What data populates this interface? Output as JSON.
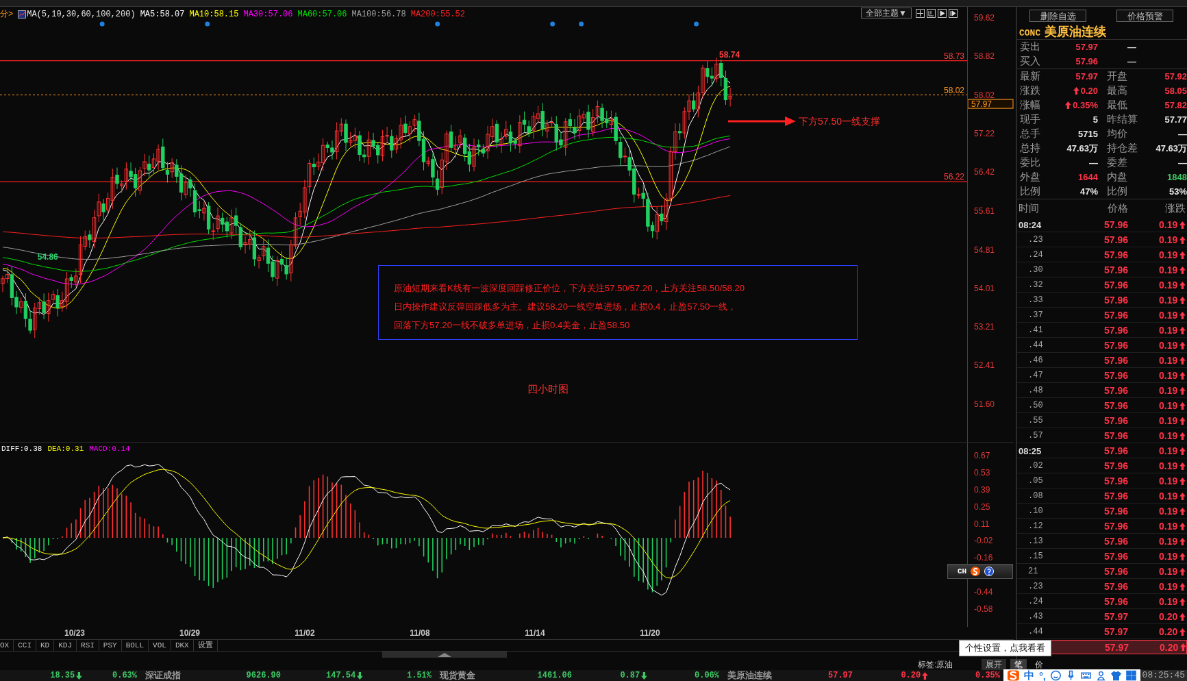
{
  "legend": {
    "period": "分>",
    "formula": "MA(5,10,30,60,100,200)",
    "values": [
      {
        "label": "MA5:58.07",
        "color": "#ffffff"
      },
      {
        "label": "MA10:58.15",
        "color": "#ffff00"
      },
      {
        "label": "MA30:57.06",
        "color": "#ff00ff"
      },
      {
        "label": "MA60:57.06",
        "color": "#00e000"
      },
      {
        "label": "MA100:56.78",
        "color": "#a0a0a0"
      },
      {
        "label": "MA200:55.52",
        "color": "#ff2020"
      }
    ]
  },
  "theme_button": "全部主题▼",
  "price_axis": [
    "59.62",
    "58.82",
    "58.02",
    "57.22",
    "56.42",
    "55.61",
    "54.81",
    "54.01",
    "53.21",
    "52.41",
    "51.60"
  ],
  "price_markers": [
    {
      "label": "58.73",
      "kind": "line"
    },
    {
      "label": "58.02",
      "kind": "dashed"
    },
    {
      "label": "57.97",
      "kind": "current"
    },
    {
      "label": "56.22",
      "kind": "line"
    }
  ],
  "extremes": [
    {
      "label": "58.74",
      "kind": "high"
    },
    {
      "label": "54.86",
      "kind": "low"
    }
  ],
  "callout": "下方57.50一线支撑",
  "note": [
    "原油短期来看K线有一波深度回踩修正价位，下方关注57.50/57.20，上方关注58.50/58.20",
    "日内操作建议反弹回踩低多为主。建议58.20一线空单进场，止损0.4，止盈57.50一线，",
    "回落下方57.20一线不破多单进场，止损0.4美金，止盈58.50"
  ],
  "caption": "四小时图",
  "macd_legend": [
    {
      "label": "DIFF:0.38",
      "color": "#ffffff"
    },
    {
      "label": "DEA:0.31",
      "color": "#ffff00"
    },
    {
      "label": "MACD:0.14",
      "color": "#ff00ff"
    }
  ],
  "macd_axis": [
    "0.67",
    "0.53",
    "0.39",
    "0.25",
    "0.11",
    "-0.02",
    "-0.16",
    "-0.44",
    "-0.58"
  ],
  "dates": [
    "10/23",
    "10/29",
    "11/02",
    "11/08",
    "11/14",
    "11/20"
  ],
  "indicator_tabs": [
    "OX",
    "CCI",
    "KD",
    "KDJ",
    "RSI",
    "PSY",
    "BOLL",
    "VOL",
    "DKX",
    "设置"
  ],
  "tag_label": "标签:原油",
  "expand_button": "展开",
  "detail_tabs": [
    {
      "label": "笔",
      "selected": true
    },
    {
      "label": "价",
      "selected": false
    }
  ],
  "tooltip": "个性设置，点我看看",
  "input_widget": "CH",
  "quote": {
    "buttons": [
      "删除自选",
      "价格预警"
    ],
    "code": "CONC",
    "name": "美原油连续",
    "order_book": [
      {
        "label": "卖出",
        "price": "57.97",
        "volume": "—"
      },
      {
        "label": "买入",
        "price": "57.96",
        "volume": "—"
      }
    ],
    "fields": [
      {
        "label": "最新",
        "value": "57.97",
        "color": "#ff3448",
        "kind": "plain"
      },
      {
        "label": "开盘",
        "value": "57.92",
        "color": "#ff3448",
        "kind": "plain"
      },
      {
        "label": "涨跌",
        "value": "0.20",
        "color": "#ff3448",
        "kind": "up"
      },
      {
        "label": "最高",
        "value": "58.05",
        "color": "#ff3448",
        "kind": "plain"
      },
      {
        "label": "涨幅",
        "value": "0.35%",
        "color": "#ff3448",
        "kind": "up"
      },
      {
        "label": "最低",
        "value": "57.82",
        "color": "#ff3448",
        "kind": "plain"
      },
      {
        "label": "现手",
        "value": "5",
        "color": "#e6e6e6",
        "kind": "plain"
      },
      {
        "label": "昨结算",
        "value": "57.77",
        "color": "#e6e6e6",
        "kind": "plain"
      },
      {
        "label": "总手",
        "value": "5715",
        "color": "#e6e6e6",
        "kind": "plain"
      },
      {
        "label": "均价",
        "value": "—",
        "color": "#e6e6e6",
        "kind": "plain"
      },
      {
        "label": "总持",
        "value": "47.63万",
        "color": "#e6e6e6",
        "kind": "plain"
      },
      {
        "label": "持仓差",
        "value": "47.63万",
        "color": "#e6e6e6",
        "kind": "plain"
      },
      {
        "label": "委比",
        "value": "—",
        "color": "#e6e6e6",
        "kind": "plain"
      },
      {
        "label": "委差",
        "value": "—",
        "color": "#e6e6e6",
        "kind": "plain"
      },
      {
        "label": "外盘",
        "value": "1644",
        "color": "#ff3448",
        "kind": "plain"
      },
      {
        "label": "内盘",
        "value": "1848",
        "color": "#3cc864",
        "kind": "plain"
      },
      {
        "label": "比例",
        "value": "47%",
        "color": "#e6e6e6",
        "kind": "plain"
      },
      {
        "label": "比例",
        "value": "53%",
        "color": "#e6e6e6",
        "kind": "plain"
      }
    ]
  },
  "trades": {
    "columns": [
      "时间",
      "价格",
      "涨跌"
    ],
    "rows": [
      {
        "time": "08:24",
        "kind": "minute",
        "price": "57.96",
        "change": "0.19",
        "selected": false
      },
      {
        "time": ".23",
        "kind": "second",
        "price": "57.96",
        "change": "0.19",
        "selected": false
      },
      {
        "time": ".24",
        "kind": "second",
        "price": "57.96",
        "change": "0.19",
        "selected": false
      },
      {
        "time": ".30",
        "kind": "second",
        "price": "57.96",
        "change": "0.19",
        "selected": false
      },
      {
        "time": ".32",
        "kind": "second",
        "price": "57.96",
        "change": "0.19",
        "selected": false
      },
      {
        "time": ".33",
        "kind": "second",
        "price": "57.96",
        "change": "0.19",
        "selected": false
      },
      {
        "time": ".37",
        "kind": "second",
        "price": "57.96",
        "change": "0.19",
        "selected": false
      },
      {
        "time": ".41",
        "kind": "second",
        "price": "57.96",
        "change": "0.19",
        "selected": false
      },
      {
        "time": ".44",
        "kind": "second",
        "price": "57.96",
        "change": "0.19",
        "selected": false
      },
      {
        "time": ".46",
        "kind": "second",
        "price": "57.96",
        "change": "0.19",
        "selected": false
      },
      {
        "time": ".47",
        "kind": "second",
        "price": "57.96",
        "change": "0.19",
        "selected": false
      },
      {
        "time": ".48",
        "kind": "second",
        "price": "57.96",
        "change": "0.19",
        "selected": false
      },
      {
        "time": ".50",
        "kind": "second",
        "price": "57.96",
        "change": "0.19",
        "selected": false
      },
      {
        "time": ".55",
        "kind": "second",
        "price": "57.96",
        "change": "0.19",
        "selected": false
      },
      {
        "time": ".57",
        "kind": "second",
        "price": "57.96",
        "change": "0.19",
        "selected": false
      },
      {
        "time": "08:25",
        "kind": "minute",
        "price": "57.96",
        "change": "0.19",
        "selected": false
      },
      {
        "time": ".02",
        "kind": "second",
        "price": "57.96",
        "change": "0.19",
        "selected": false
      },
      {
        "time": ".05",
        "kind": "second",
        "price": "57.96",
        "change": "0.19",
        "selected": false
      },
      {
        "time": ".08",
        "kind": "second",
        "price": "57.96",
        "change": "0.19",
        "selected": false
      },
      {
        "time": ".10",
        "kind": "second",
        "price": "57.96",
        "change": "0.19",
        "selected": false
      },
      {
        "time": ".12",
        "kind": "second",
        "price": "57.96",
        "change": "0.19",
        "selected": false
      },
      {
        "time": ".13",
        "kind": "second",
        "price": "57.96",
        "change": "0.19",
        "selected": false
      },
      {
        "time": ".15",
        "kind": "second",
        "price": "57.96",
        "change": "0.19",
        "selected": false
      },
      {
        "time": "21",
        "kind": "second",
        "price": "57.96",
        "change": "0.19",
        "selected": false
      },
      {
        "time": ".23",
        "kind": "second",
        "price": "57.96",
        "change": "0.19",
        "selected": false
      },
      {
        "time": ".24",
        "kind": "second",
        "price": "57.96",
        "change": "0.19",
        "selected": false
      },
      {
        "time": ".43",
        "kind": "second",
        "price": "57.97",
        "change": "0.20",
        "selected": false
      },
      {
        "time": ".44",
        "kind": "second",
        "price": "57.97",
        "change": "0.20",
        "selected": false
      },
      {
        "kind": "second",
        "price": "57.97",
        "change": "0.20",
        "selected": true
      }
    ]
  },
  "ticker": [
    {
      "text": "18.35",
      "kind": "down",
      "color": "#3cc864"
    },
    {
      "text": "0.63%",
      "kind": "value",
      "color": "#3cc864"
    },
    {
      "text": "深证成指",
      "kind": "name"
    },
    {
      "text": "9626.90",
      "kind": "value",
      "color": "#3cc864"
    },
    {
      "text": "147.54",
      "kind": "down",
      "color": "#3cc864"
    },
    {
      "text": "1.51%",
      "kind": "value",
      "color": "#3cc864"
    },
    {
      "text": "现货黄金",
      "kind": "name"
    },
    {
      "text": "1461.06",
      "kind": "value",
      "color": "#3cc864"
    },
    {
      "text": "0.87",
      "kind": "down",
      "color": "#3cc864"
    },
    {
      "text": "0.06%",
      "kind": "value",
      "color": "#3cc864"
    },
    {
      "text": "美原油连续",
      "kind": "name"
    },
    {
      "text": "57.97",
      "kind": "value",
      "color": "#ff3448"
    },
    {
      "text": "0.20",
      "kind": "up",
      "color": "#ff3448"
    },
    {
      "text": "0.35%",
      "kind": "value",
      "color": "#ff3448"
    }
  ],
  "ime": {
    "mode": "中",
    "punct": "°,"
  },
  "clock": "08:25:45"
}
